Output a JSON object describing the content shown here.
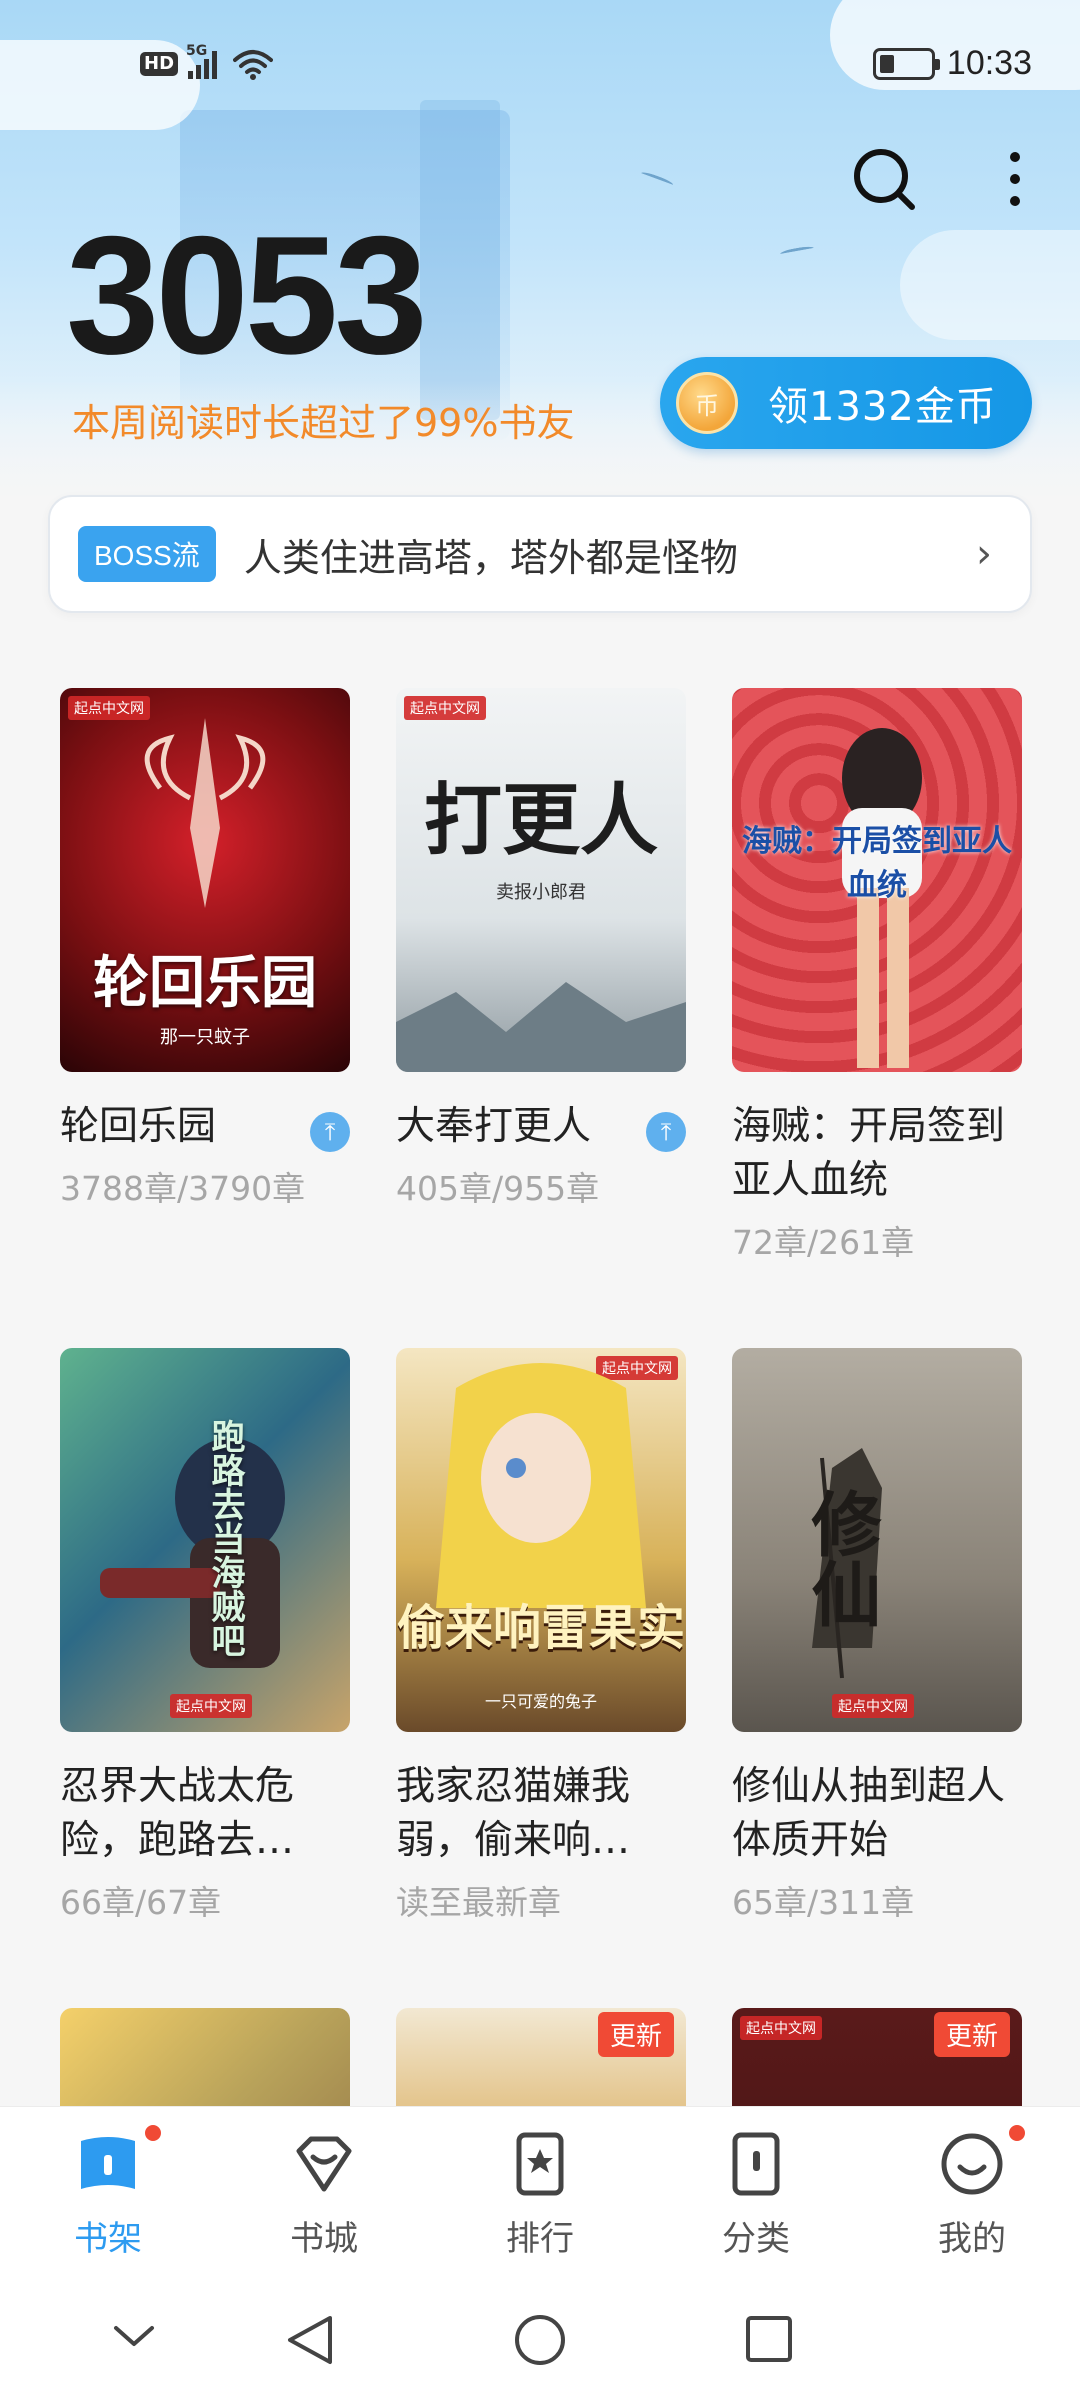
{
  "status_bar": {
    "hd": "HD",
    "network": "5G",
    "time": "10:33"
  },
  "header": {
    "reading_minutes": "3053",
    "reading_stat": "本周阅读时长超过了99%书友",
    "coin_button_label": "领1332金币",
    "coin_icon_glyph": "币",
    "search_icon": "search-icon",
    "more_icon": "more-vertical-icon"
  },
  "recommendation": {
    "tag": "BOSS流",
    "text": "人类住进高塔，塔外都是怪物",
    "arrow": "›"
  },
  "books": [
    {
      "title": "轮回乐园",
      "progress": "3788章/3790章",
      "pinned": true,
      "cover_title": "轮回乐园",
      "cover_author": "那一只蚊子",
      "cover_color": "#7a0f12"
    },
    {
      "title": "大奉打更人",
      "progress": "405章/955章",
      "pinned": true,
      "cover_title": "打更人",
      "cover_author": "卖报小郎君",
      "cover_color": "#e7ebee"
    },
    {
      "title": "海贼：开局签到亚人血统",
      "progress": "72章/261章",
      "pinned": false,
      "cover_title": "海贼：开局签到亚人血统",
      "cover_color": "#e4545a"
    },
    {
      "title": "忍界大战太危险，跑路去…",
      "progress": "66章/67章",
      "pinned": false,
      "cover_title": "跑路去当海贼吧",
      "cover_color": "#4a8a7a"
    },
    {
      "title": "我家忍猫嫌我弱，偷来响…",
      "progress": "读至最新章",
      "pinned": false,
      "cover_title": "偷来响雷果实",
      "cover_author": "一只可爱的兔子",
      "cover_color": "#c9a14a"
    },
    {
      "title": "修仙从抽到超人体质开始",
      "progress": "65章/311章",
      "pinned": false,
      "cover_title": "修仙",
      "cover_color": "#8a8378"
    }
  ],
  "partial_books": [
    {
      "update_tag": "",
      "cover_color": "#b8a25a"
    },
    {
      "update_tag": "更新",
      "cover_color": "#d6c7a5"
    },
    {
      "update_tag": "更新",
      "cover_color": "#6b2a2a"
    }
  ],
  "brand": "起点中文网",
  "bottom_nav": [
    {
      "label": "书架",
      "icon": "bookshelf-icon",
      "active": true,
      "dot": true
    },
    {
      "label": "书城",
      "icon": "bookstore-icon",
      "active": false,
      "dot": false
    },
    {
      "label": "排行",
      "icon": "ranking-icon",
      "active": false,
      "dot": false
    },
    {
      "label": "分类",
      "icon": "category-icon",
      "active": false,
      "dot": false
    },
    {
      "label": "我的",
      "icon": "profile-icon",
      "active": false,
      "dot": true
    }
  ],
  "colors": {
    "accent": "#2d9bf0",
    "stat_orange": "#f28a2a",
    "red_badge": "#f04a35"
  }
}
